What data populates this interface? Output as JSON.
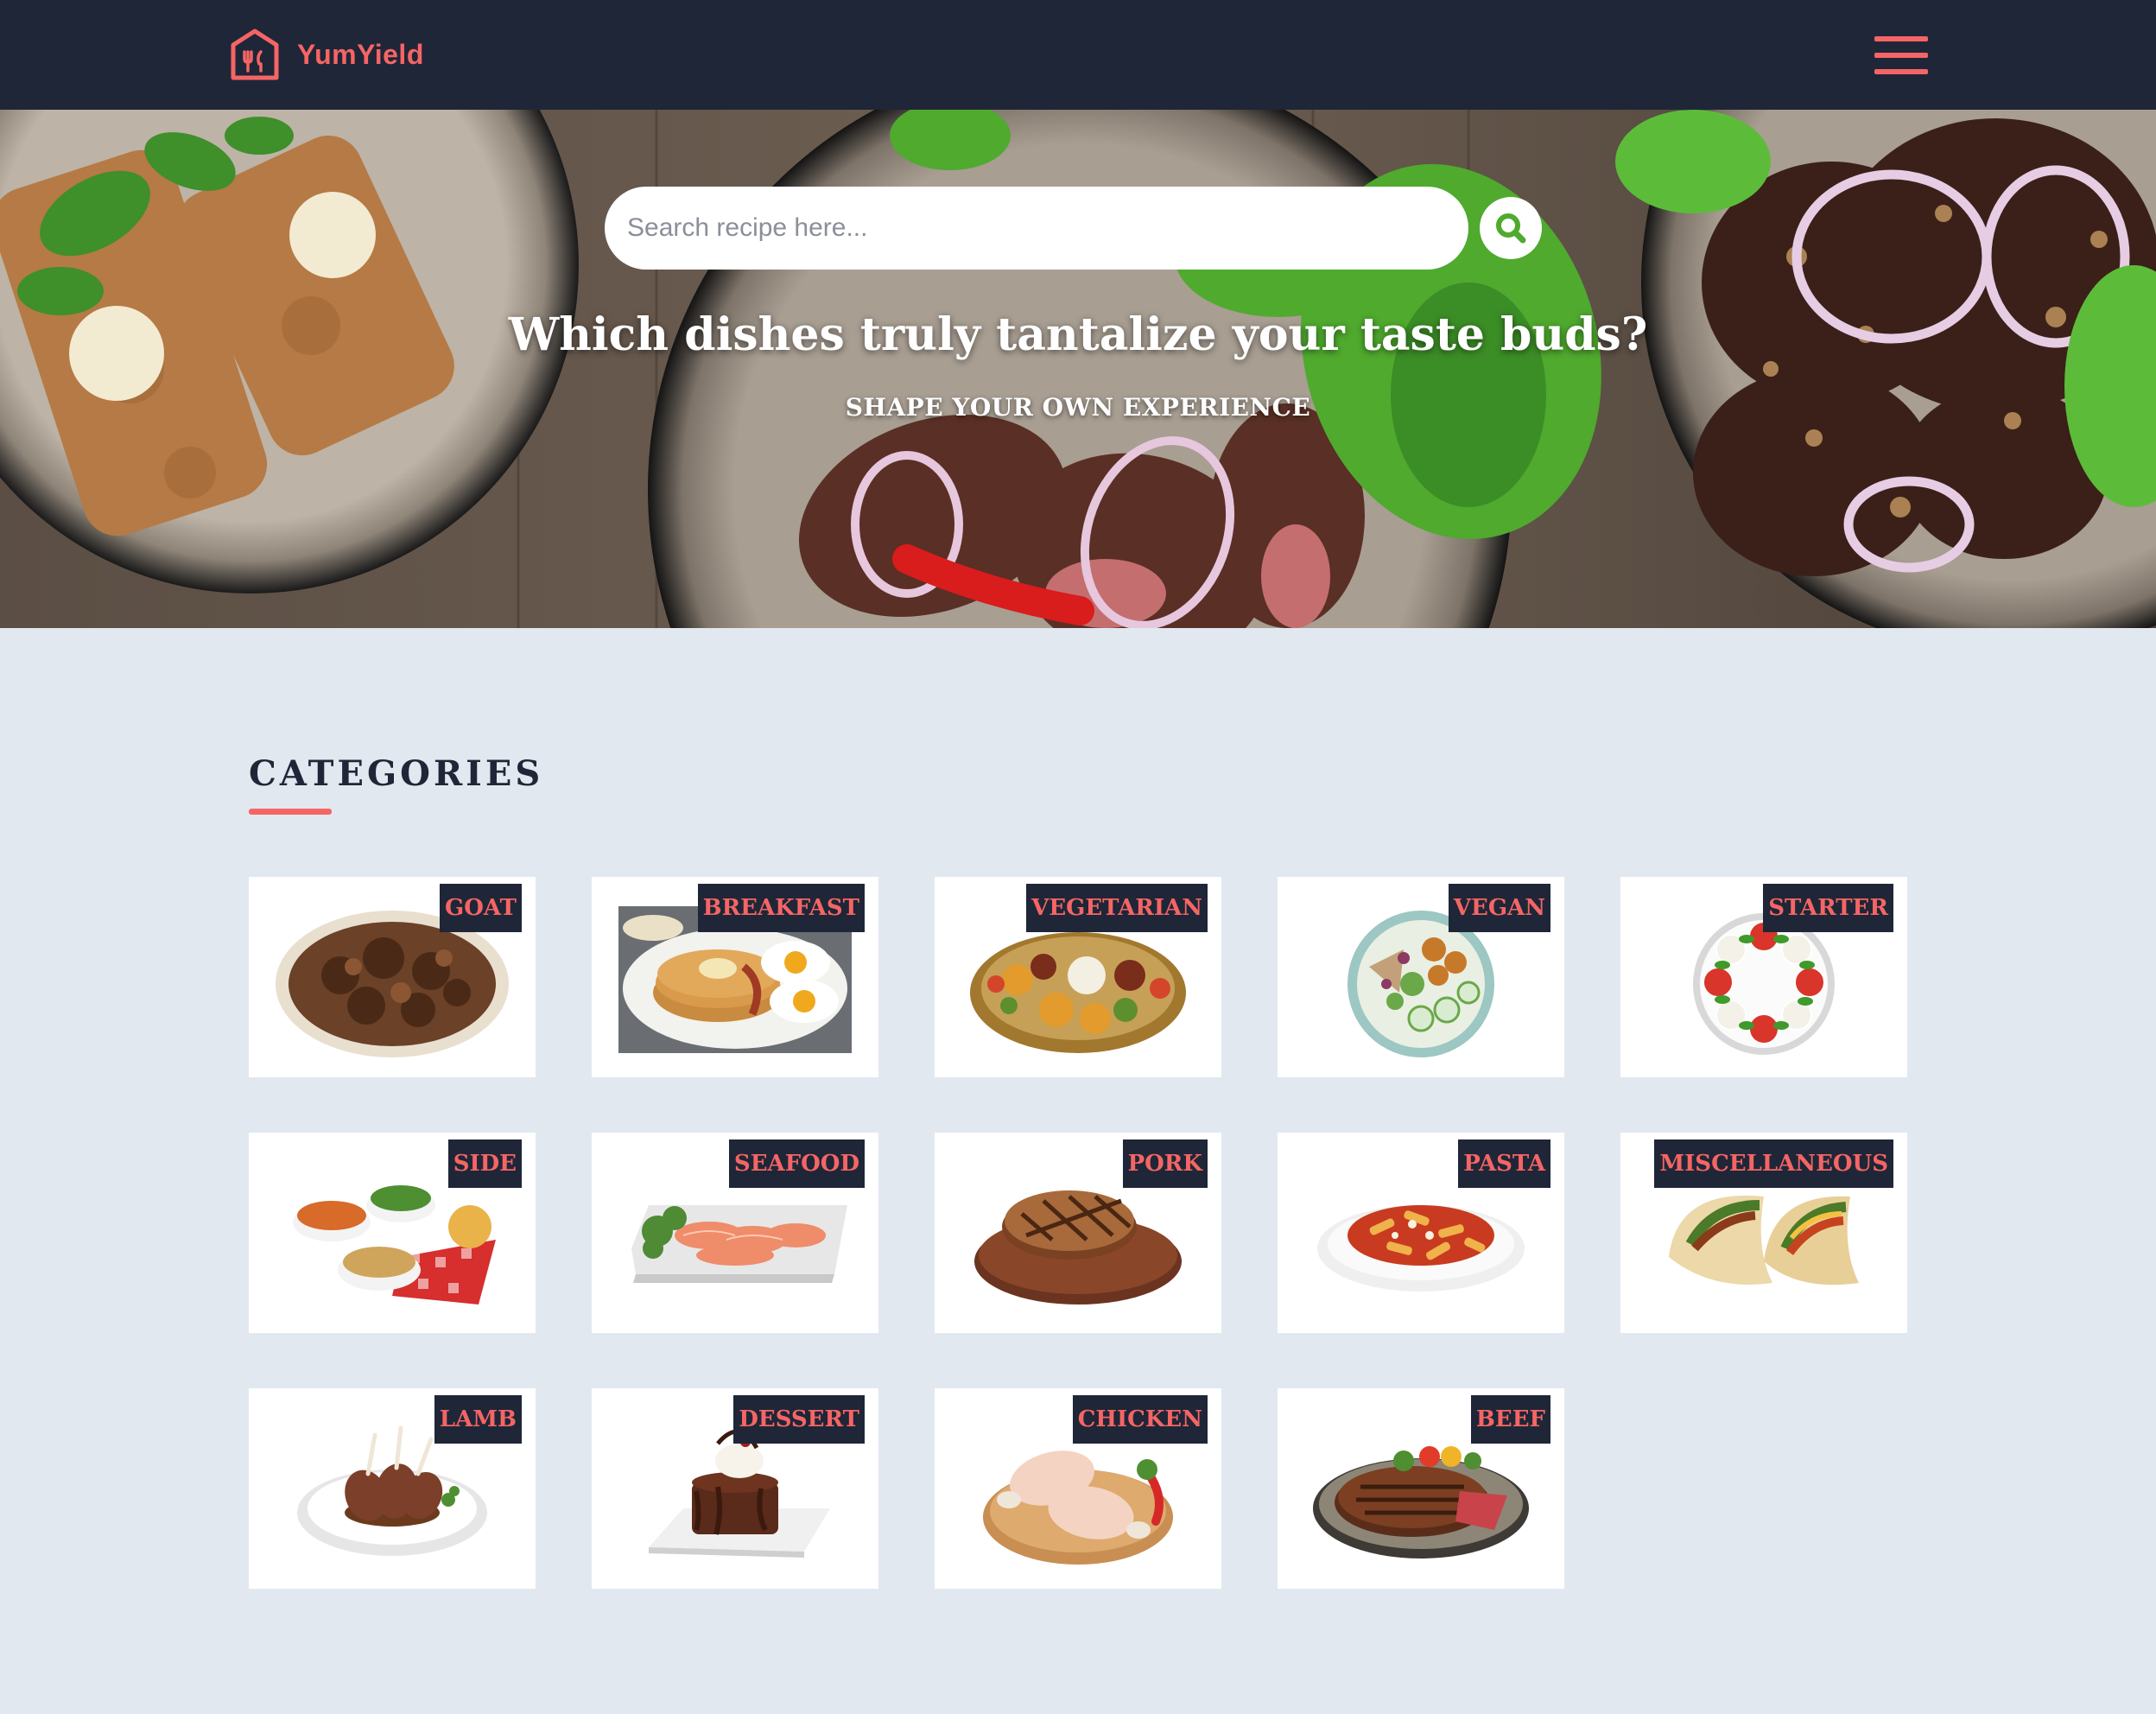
{
  "navbar": {
    "brand_name": "YumYield",
    "brand_icon": "house-fork-knife-icon",
    "menu_icon": "hamburger-menu-icon"
  },
  "hero": {
    "search_placeholder": "Search recipe here...",
    "search_value": "",
    "search_icon": "magnifier-icon",
    "title": "Which dishes truly tantalize your taste buds?",
    "subtitle": "SHAPE YOUR OWN EXPERIENCE"
  },
  "categories": {
    "heading": "CATEGORIES",
    "items": [
      {
        "label": "GOAT",
        "icon": "goat-stew-image"
      },
      {
        "label": "BREAKFAST",
        "icon": "pancakes-eggs-image"
      },
      {
        "label": "VEGETARIAN",
        "icon": "thali-platter-image"
      },
      {
        "label": "VEGAN",
        "icon": "vegan-bowl-image"
      },
      {
        "label": "STARTER",
        "icon": "caprese-plate-image"
      },
      {
        "label": "SIDE",
        "icon": "side-dishes-image"
      },
      {
        "label": "SEAFOOD",
        "icon": "salmon-plate-image"
      },
      {
        "label": "PORK",
        "icon": "pork-chop-image"
      },
      {
        "label": "PASTA",
        "icon": "penne-pasta-image"
      },
      {
        "label": "MISCELLANEOUS",
        "icon": "tacos-image"
      },
      {
        "label": "LAMB",
        "icon": "lamb-rack-image"
      },
      {
        "label": "DESSERT",
        "icon": "chocolate-cake-image"
      },
      {
        "label": "CHICKEN",
        "icon": "chicken-legs-image"
      },
      {
        "label": "BEEF",
        "icon": "steak-image"
      }
    ]
  },
  "colors": {
    "navbar_bg": "#1f2637",
    "accent": "#f56565",
    "page_bg": "#e2e8f0",
    "card_bg": "#ffffff",
    "label_bg": "#1f2637"
  }
}
